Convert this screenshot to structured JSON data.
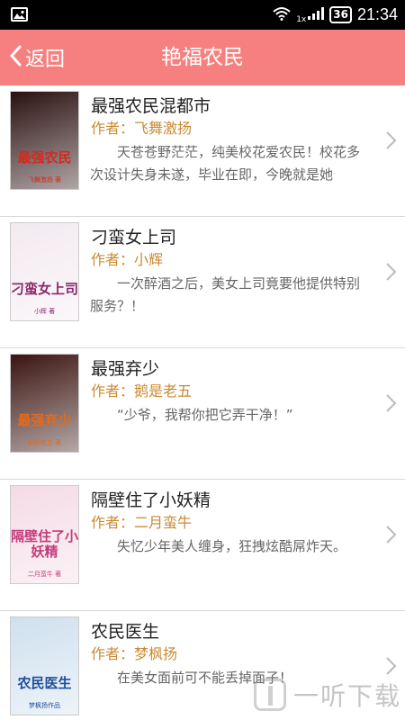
{
  "status_bar": {
    "time": "21:34",
    "battery": "36",
    "net_label": "1x"
  },
  "header": {
    "back_label": "返回",
    "title": "艳福农民"
  },
  "books": [
    {
      "title": "最强农民混都市",
      "author": "作者：飞舞激扬",
      "description": "天苍苍野茫茫，纯美校花爱农民！校花多次设计失身未遂，毕业在即，今晚就是她",
      "cover": {
        "text": "最强农民",
        "author": "飞舞激扬 著",
        "bg": "#2a1010",
        "fg": "#d42a1e"
      }
    },
    {
      "title": "刁蛮女上司",
      "author": "作者：小辉",
      "description": "一次醉酒之后，美女上司竟要他提供特别服务？！",
      "cover": {
        "text": "刁蛮女上司",
        "author": "小辉 著",
        "bg": "#f3eaf0",
        "fg": "#8a2a6a"
      }
    },
    {
      "title": "最强弃少",
      "author": "作者：鹅是老五",
      "description": "“少爷，我帮你把它弄干净！”",
      "cover": {
        "text": "最强弃少",
        "author": "鹅是老五 著",
        "bg": "#3a1410",
        "fg": "#e56a1a"
      }
    },
    {
      "title": "隔壁住了小妖精",
      "author": "作者：二月蛮牛",
      "description": "失忆少年美人缠身，狂拽炫酷屌炸天。",
      "cover": {
        "text": "隔壁住了小妖精",
        "author": "二月蛮牛 著",
        "bg": "#f4dbe6",
        "fg": "#c53b7a"
      }
    },
    {
      "title": "农民医生",
      "author": "作者：梦枫扬",
      "description": "在美女面前可不能丢掉面子！",
      "cover": {
        "text": "农民医生",
        "author": "梦枫扬作品",
        "bg": "#cfe0ee",
        "fg": "#1e4e9a"
      }
    }
  ],
  "watermark": {
    "text": "一听下载"
  },
  "colors": {
    "header_bg": "#f6807f",
    "author": "#c98a33",
    "divider": "#d9d9d9"
  },
  "icons": {
    "back": "chevron-left-icon",
    "row": "chevron-right-icon"
  }
}
